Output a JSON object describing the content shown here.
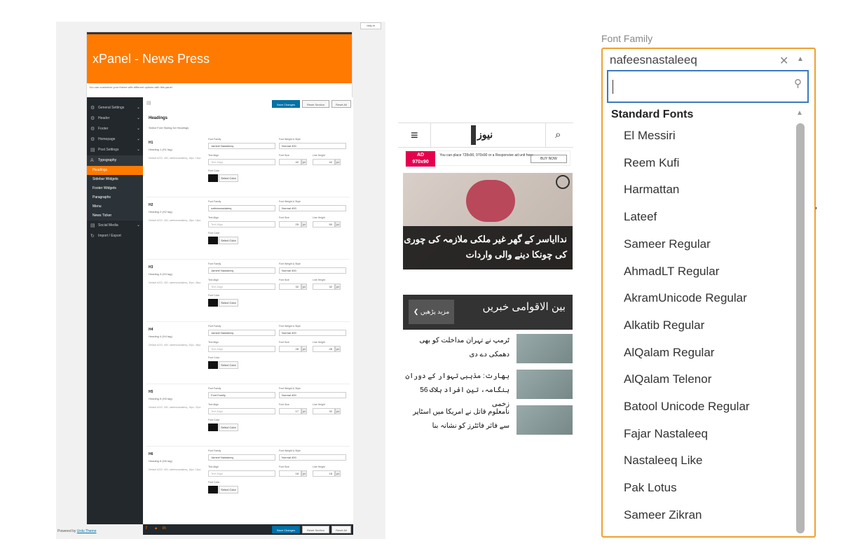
{
  "panel1": {
    "help": "Help ▾",
    "title": "xPanel - News Press",
    "subtitle": "You can customize your theme with different options with this panel",
    "menu": [
      {
        "label": "General Settings",
        "icon": "⚙"
      },
      {
        "label": "Header",
        "icon": "⚙"
      },
      {
        "label": "Footer",
        "icon": "⚙"
      },
      {
        "label": "Homepage",
        "icon": "⚙"
      },
      {
        "label": "Post Settings",
        "icon": "▤"
      },
      {
        "label": "Typography",
        "icon": "A"
      }
    ],
    "submenu": [
      "Headings",
      "Sidebar Widgets",
      "Footer Widgets",
      "Paragraphs",
      "Menu",
      "News Ticker"
    ],
    "menu2": [
      {
        "label": "Social Media",
        "icon": "▤"
      },
      {
        "label": "Import / Export",
        "icon": "↻"
      }
    ],
    "buttons": {
      "save": "Save Changes",
      "reset_section": "Reset Section",
      "reset_all": "Reset All"
    },
    "section_title": "Headings",
    "section_desc": "Select Font Styling for Headings",
    "field_labels": {
      "family": "Font Family",
      "weight": "Font Weight & Style",
      "align": "Text Align",
      "size": "Font Size",
      "lh": "Line Height",
      "color": "Font Color",
      "select_color": "Select Color",
      "px": "px"
    },
    "headings": [
      {
        "h": "H1",
        "tag": "Heading 1 (H1 tag)",
        "def": "Default #222, 400, nafeesnastaleeq, 18px, 19px",
        "family": "Jameel Nastaleeq",
        "weight": "Normal 400",
        "align": "Text Align",
        "size": "42",
        "lh": "42"
      },
      {
        "h": "H2",
        "tag": "Heading 2 (H2 tag)",
        "def": "Default #222, 400, nafeesnastaleeq, 18px, 18px",
        "family": "nafeesnastaleeq",
        "weight": "Normal 400",
        "align": "Text Align",
        "size": "25",
        "lh": "50"
      },
      {
        "h": "H3",
        "tag": "Heading 3 (H3 tag)",
        "def": "Default #222, 400, nafeesnastaleeq, 30px, 48px",
        "family": "Jameel Nastaleeq",
        "weight": "Normal 400",
        "align": "Text Align",
        "size": "32",
        "lh": "32"
      },
      {
        "h": "H4",
        "tag": "Heading 4 (H4 tag)",
        "def": "Default #222, 400, nafeesnastaleeq, 20px, 48px",
        "family": "Jameel Nastaleeq",
        "weight": "Normal 400",
        "align": "Text Align",
        "size": "28",
        "lh": "28"
      },
      {
        "h": "H5",
        "tag": "Heading 5 (H5 tag)",
        "def": "Default #222, 400, nafeesnastaleeq, 16px, 32px",
        "family": "Font Family",
        "weight": "Normal 400",
        "align": "Text Align",
        "size": "17",
        "lh": "32"
      },
      {
        "h": "H6",
        "tag": "Heading 6 (H6 tag)",
        "def": "Default #222, 400, nafeesnastaleeq, 16px, 16px",
        "family": "Jameel Nastaleeq",
        "weight": "Normal 400",
        "align": "Text Align",
        "size": "18",
        "lh": "18"
      }
    ],
    "powered_prefix": "Powered by",
    "powered_link": "Urdu Theme"
  },
  "panel2": {
    "logo": "نیوز",
    "ad": {
      "size_line1": "AD",
      "size_line2": "970x90",
      "text": "You can place 728x90, 970x90 or a Responsive ad unit here",
      "buy": "BUY NOW"
    },
    "featured_title": "نداایاسر کے گھر غیر ملکی ملازمہ کی چوری کی چونکا دینے والی واردات",
    "section_title": "بین الاقوامی خبریں",
    "more_btn": "مزید پڑھیں",
    "news": [
      "ٹرمپ نے تہران مداخلت کو بھی دھمکی دے دی",
      "بھارت: مذہبی تہوار کے دوران ہنگامہ، تین افراد ہلاک 56 زخمی",
      "نامعلوم قاتل نے امریکا میں اسٹاپر سے فائر فائٹرز کو نشانہ بنا"
    ]
  },
  "panel3": {
    "label": "Font Family",
    "value": "nafeesnastaleeq",
    "group": "Standard Fonts",
    "options": [
      "El Messiri",
      "Reem Kufi",
      "Harmattan",
      "Lateef",
      "Sameer Regular",
      "AhmadLT Regular",
      "AkramUnicode Regular",
      "Alkatib Regular",
      "AlQalam Regular",
      "AlQalam Telenor",
      "Batool Unicode Regular",
      "Fajar Nastaleeq",
      "Nastaleeq Like",
      "Pak Lotus",
      "Sameer Zikran"
    ]
  },
  "colors": {
    "brand": "#ff7a00",
    "primary_btn": "#0073aa",
    "sidebar": "#23282d",
    "focus": "#3a7abf"
  }
}
